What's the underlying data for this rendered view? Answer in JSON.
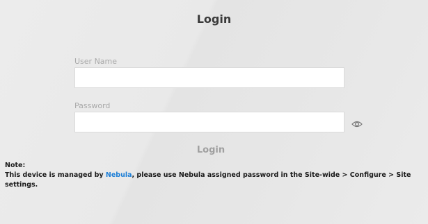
{
  "login": {
    "title": "Login",
    "username_label": "User Name",
    "username_value": "",
    "password_label": "Password",
    "password_value": "",
    "show_password_icon": "eye-icon",
    "submit_label": "Login"
  },
  "note": {
    "title": "Note:",
    "text_before": "This device is managed by ",
    "link": "Nebula",
    "text_after": ", please use Nebula assigned password in the Site-wide > Configure > Site settings."
  },
  "colors": {
    "link": "#1e7fd6",
    "background": "#e8e8e8"
  }
}
